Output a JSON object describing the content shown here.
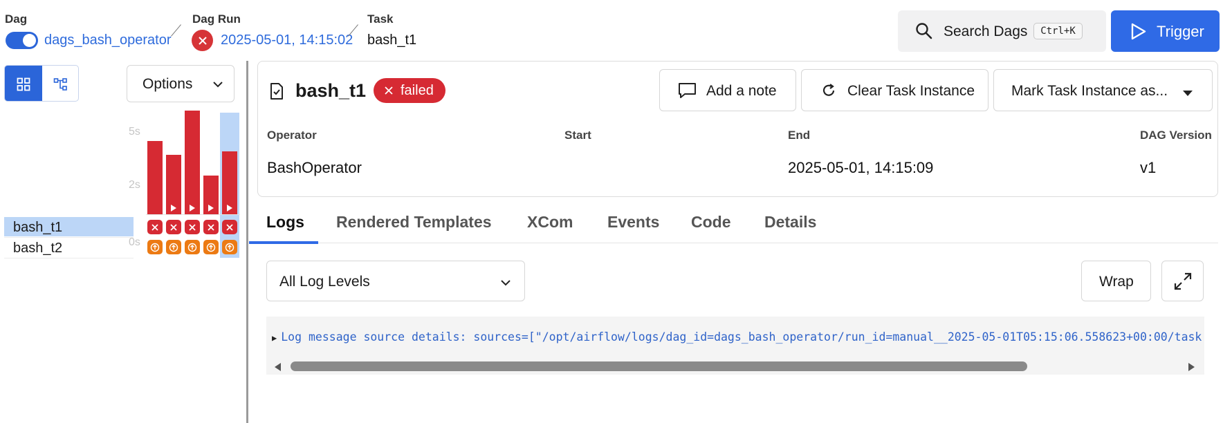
{
  "header": {
    "dag_label": "Dag",
    "dag_name": "dags_bash_operator",
    "dag_run_label": "Dag Run",
    "dag_run_value": "2025-05-01, 14:15:02",
    "task_label": "Task",
    "task_value": "bash_t1",
    "search_label": "Search Dags",
    "search_shortcut": "Ctrl+K",
    "trigger_label": "Trigger"
  },
  "grid": {
    "options_label": "Options",
    "axis_ticks": [
      "5s",
      "2s",
      "0s"
    ],
    "durations_s": [
      3.6,
      2.9,
      5.1,
      1.9,
      3.1
    ],
    "tasks": [
      "bash_t1",
      "bash_t2"
    ],
    "selected_task": "bash_t1"
  },
  "task_detail": {
    "title": "bash_t1",
    "status": "failed",
    "add_note_label": "Add a note",
    "clear_label": "Clear Task Instance",
    "mark_label": "Mark Task Instance as...",
    "meta": {
      "operator_label": "Operator",
      "operator_value": "BashOperator",
      "start_label": "Start",
      "start_value": "",
      "end_label": "End",
      "end_value": "2025-05-01, 14:15:09",
      "version_label": "DAG Version",
      "version_value": "v1"
    }
  },
  "tabs": [
    "Logs",
    "Rendered Templates",
    "XCom",
    "Events",
    "Code",
    "Details"
  ],
  "logs": {
    "level_select": "All Log Levels",
    "wrap_label": "Wrap",
    "line": "Log message source details: sources=[\"/opt/airflow/logs/dag_id=dags_bash_operator/run_id=manual__2025-05-01T05:15:06.558623+00:00/task"
  },
  "colors": {
    "accent": "#2f6ae6",
    "failed": "#d62a33",
    "upstream_failed": "#ec7a13",
    "selected": "#bcd6f7"
  }
}
